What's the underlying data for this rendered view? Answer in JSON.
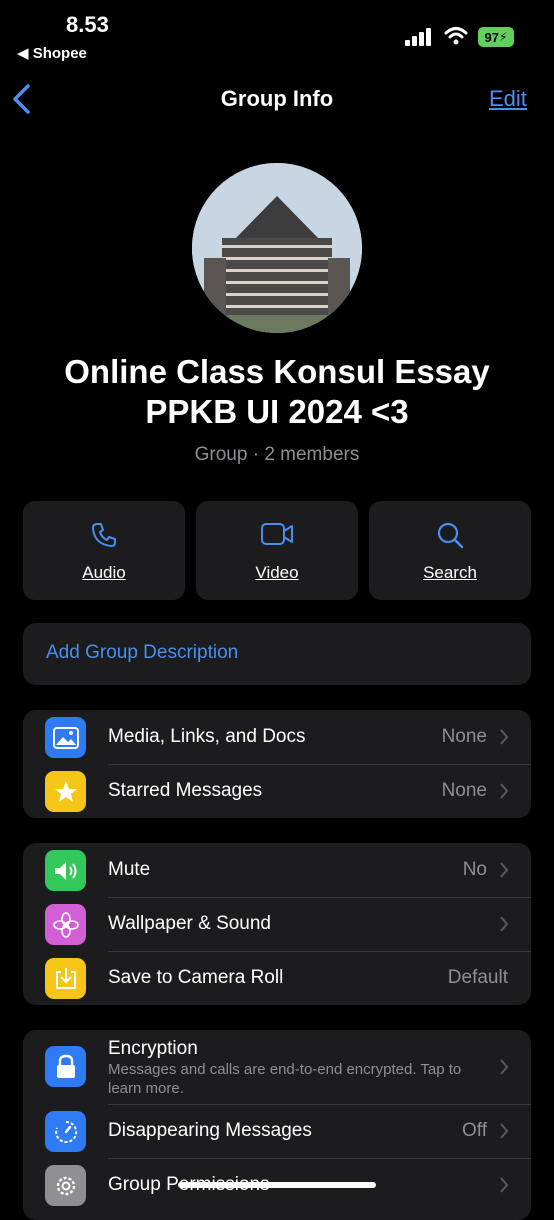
{
  "status_bar": {
    "time": "8.53",
    "back_app": "◀ Shopee",
    "battery": "97"
  },
  "nav": {
    "title": "Group Info",
    "edit": "Edit"
  },
  "group": {
    "name_line1": "Online Class Konsul Essay",
    "name_line2": "PPKB UI 2024 <3",
    "subtitle": "Group · 2 members"
  },
  "actions": [
    {
      "label": "Audio",
      "icon": "phone-icon"
    },
    {
      "label": "Video",
      "icon": "video-camera-icon"
    },
    {
      "label": "Search",
      "icon": "search-icon"
    }
  ],
  "description": {
    "label": "Add Group Description"
  },
  "section1": [
    {
      "label": "Media, Links, and Docs",
      "value": "None",
      "icon": "photo-icon",
      "color": "#2f7bf6"
    },
    {
      "label": "Starred Messages",
      "value": "None",
      "icon": "star-icon",
      "color": "#f5c518"
    }
  ],
  "section2": [
    {
      "label": "Mute",
      "value": "No",
      "icon": "speaker-icon",
      "color": "#34c759"
    },
    {
      "label": "Wallpaper & Sound",
      "value": "",
      "icon": "flower-icon",
      "color": "#d25fd6"
    },
    {
      "label": "Save to Camera Roll",
      "value": "Default",
      "icon": "save-icon",
      "color": "#f5c518"
    }
  ],
  "section3": [
    {
      "label": "Encryption",
      "sub": "Messages and calls are end-to-end encrypted. Tap to learn more.",
      "icon": "lock-icon",
      "color": "#2f7bf6"
    },
    {
      "label": "Disappearing Messages",
      "value": "Off",
      "icon": "timer-icon",
      "color": "#2f7bf6"
    },
    {
      "label": "Group Permissions",
      "value": "",
      "icon": "gear-icon",
      "color": "#8e8e93"
    }
  ]
}
